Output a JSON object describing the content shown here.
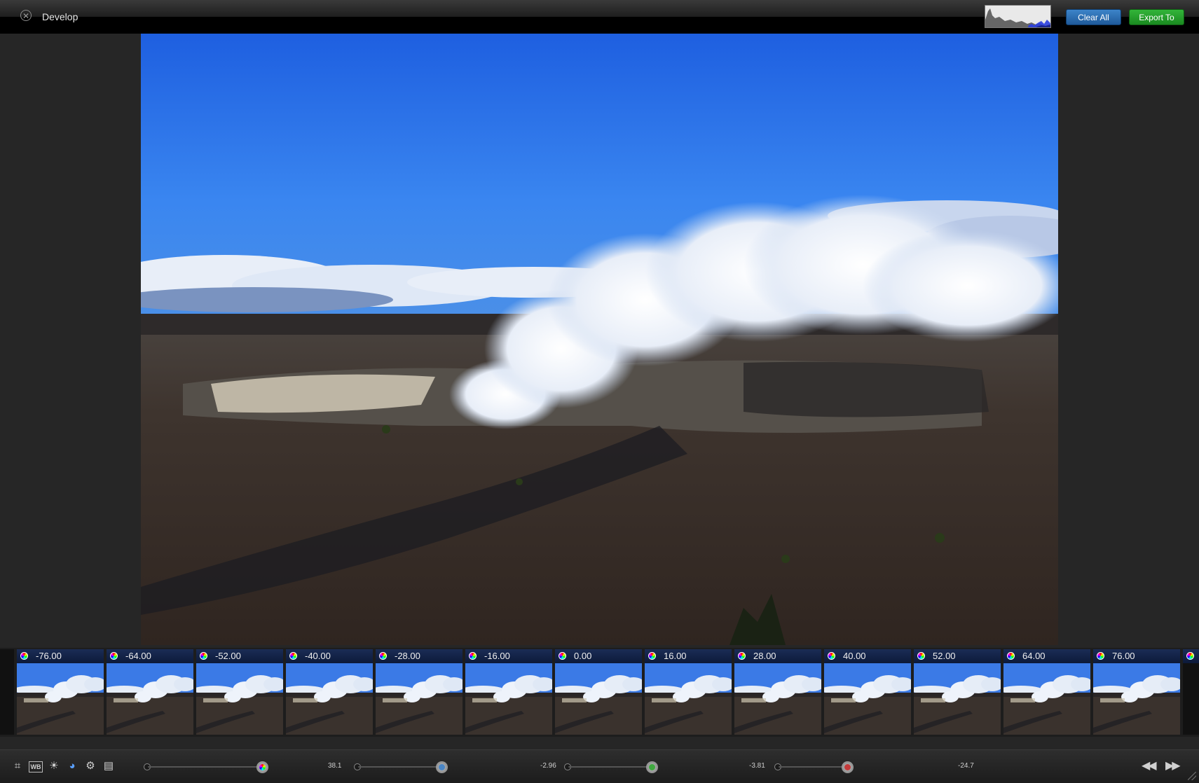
{
  "window": {
    "title": "Develop",
    "close_icon": "close-circle-icon"
  },
  "header": {
    "histogram_icon": "histogram-icon",
    "clear_all_label": "Clear All",
    "export_label": "Export To"
  },
  "colors": {
    "clear_button": "#2a6fb2",
    "export_button": "#26a02c",
    "filmstrip_caption": "#13234a"
  },
  "photo": {
    "subject": "volcanic-crater-with-steam-plume"
  },
  "filmstrip": {
    "items": [
      {
        "label": "-76.00",
        "icon": "color-wheel-icon"
      },
      {
        "label": "-64.00",
        "icon": "color-wheel-icon"
      },
      {
        "label": "-52.00",
        "icon": "color-wheel-icon"
      },
      {
        "label": "-40.00",
        "icon": "color-wheel-icon"
      },
      {
        "label": "-28.00",
        "icon": "color-wheel-icon"
      },
      {
        "label": "-16.00",
        "icon": "color-wheel-icon"
      },
      {
        "label": "0.00",
        "icon": "color-wheel-icon"
      },
      {
        "label": "16.00",
        "icon": "color-wheel-icon"
      },
      {
        "label": "28.00",
        "icon": "color-wheel-icon"
      },
      {
        "label": "40.00",
        "icon": "color-wheel-icon"
      },
      {
        "label": "52.00",
        "icon": "color-wheel-icon"
      },
      {
        "label": "64.00",
        "icon": "color-wheel-icon"
      },
      {
        "label": "76.00",
        "icon": "color-wheel-icon"
      }
    ]
  },
  "toolbar": {
    "tools": [
      {
        "name": "crop-icon",
        "glyph": "⌗"
      },
      {
        "name": "white-balance-icon",
        "glyph": "WB"
      },
      {
        "name": "exposure-sun-icon",
        "glyph": "☀"
      },
      {
        "name": "color-palette-icon",
        "glyph": "◕"
      },
      {
        "name": "detail-gear-icon",
        "glyph": "⚙"
      },
      {
        "name": "levels-icon",
        "glyph": "▤"
      }
    ],
    "sliders": [
      {
        "name": "hue-slider",
        "value": "38.1",
        "knob_color": "rainbow"
      },
      {
        "name": "blue-slider",
        "value": "-2.96",
        "knob_color": "#4a86c6"
      },
      {
        "name": "green-slider",
        "value": "-3.81",
        "knob_color": "#3fa83f"
      },
      {
        "name": "red-slider",
        "value": "-24.7",
        "knob_color": "#c43a3a"
      }
    ],
    "prev_icon": "skip-back-icon",
    "next_icon": "skip-forward-icon"
  }
}
